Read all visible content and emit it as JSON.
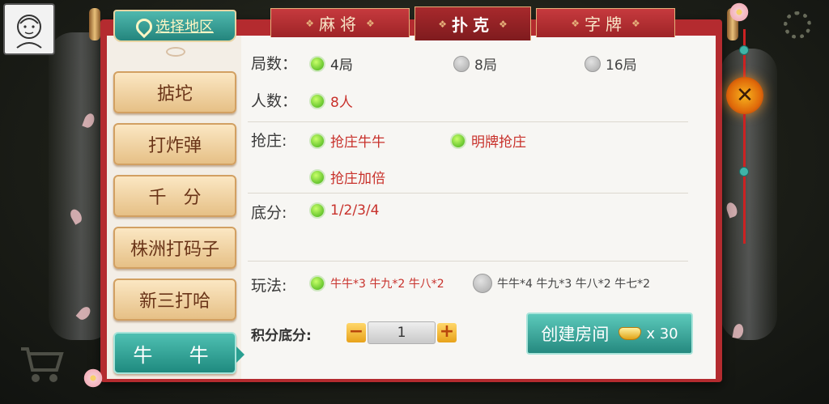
{
  "region_button": {
    "label": "选择地区",
    "icon": "map-pin-icon"
  },
  "tabs": [
    {
      "label": "麻将",
      "active": false
    },
    {
      "label": "扑克",
      "active": true
    },
    {
      "label": "字牌",
      "active": false
    }
  ],
  "sidebar": {
    "items": [
      {
        "label": "掂坨",
        "active": false
      },
      {
        "label": "打炸弹",
        "active": false
      },
      {
        "label": "千   分",
        "active": false
      },
      {
        "label": "株洲打码子",
        "active": false
      },
      {
        "label": "新三打哈",
        "active": false
      },
      {
        "label": "牛  牛",
        "active": true
      }
    ]
  },
  "options": {
    "rounds": {
      "label": "局数：",
      "choices": [
        {
          "label": "4局",
          "selected": true
        },
        {
          "label": "8局",
          "selected": false
        },
        {
          "label": "16局",
          "selected": false
        }
      ]
    },
    "players": {
      "label": "人数：",
      "choices": [
        {
          "label": "8人",
          "selected": true
        }
      ]
    },
    "banker": {
      "label": "抢庄:",
      "choices": [
        {
          "label": "抢庄牛牛",
          "selected": true
        },
        {
          "label": "明牌抢庄",
          "selected": true
        },
        {
          "label": "抢庄加倍",
          "selected": true
        }
      ]
    },
    "base_score": {
      "label": "底分:",
      "choices": [
        {
          "label": "1/2/3/4",
          "selected": true
        }
      ]
    },
    "play_mode": {
      "label": "玩法:",
      "choices": [
        {
          "label": "牛牛*3 牛九*2 牛八*2",
          "selected": true
        },
        {
          "label": "牛牛*4 牛九*3 牛八*2 牛七*2",
          "selected": false
        }
      ]
    }
  },
  "score_stepper": {
    "label": "积分底分:",
    "value": "1",
    "minus": "−",
    "plus": "+"
  },
  "create_room": {
    "label": "创建房间",
    "cost_icon": "gold-ingot-icon",
    "cost": "x 30"
  },
  "close_button": {
    "label": "✕"
  },
  "colors": {
    "panel_red": "#b42b2f",
    "teal_button": "#25897f",
    "selected_text": "#c8312b",
    "radio_on": "#3fae16"
  }
}
